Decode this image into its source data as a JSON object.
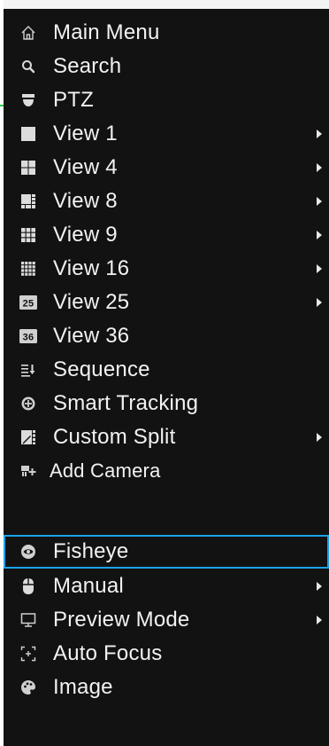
{
  "menu": {
    "items": [
      {
        "label": "Main Menu",
        "icon": "home-icon",
        "submenu": false
      },
      {
        "label": "Search",
        "icon": "search-icon",
        "submenu": false
      },
      {
        "label": "PTZ",
        "icon": "ptz-camera-icon",
        "submenu": false
      },
      {
        "label": "View 1",
        "icon": "view-1-icon",
        "submenu": true
      },
      {
        "label": "View 4",
        "icon": "view-4-icon",
        "submenu": true
      },
      {
        "label": "View 8",
        "icon": "view-8-icon",
        "submenu": true
      },
      {
        "label": "View 9",
        "icon": "view-9-icon",
        "submenu": true
      },
      {
        "label": "View 16",
        "icon": "view-16-icon",
        "submenu": true
      },
      {
        "label": "View 25",
        "icon": "view-25-icon",
        "submenu": true,
        "icon_text": "25"
      },
      {
        "label": "View 36",
        "icon": "view-36-icon",
        "submenu": false,
        "icon_text": "36"
      },
      {
        "label": "Sequence",
        "icon": "sequence-icon",
        "submenu": false
      },
      {
        "label": "Smart Tracking",
        "icon": "smart-tracking-icon",
        "submenu": false
      },
      {
        "label": "Custom Split",
        "icon": "custom-split-icon",
        "submenu": true
      },
      {
        "label": "Add Camera",
        "icon": "add-camera-icon",
        "submenu": false
      },
      {
        "label": "Fisheye",
        "icon": "fisheye-icon",
        "submenu": false,
        "selected": true
      },
      {
        "label": "Manual",
        "icon": "mouse-icon",
        "submenu": true
      },
      {
        "label": "Preview Mode",
        "icon": "monitor-icon",
        "submenu": true
      },
      {
        "label": "Auto Focus",
        "icon": "auto-focus-icon",
        "submenu": false
      },
      {
        "label": "Image",
        "icon": "image-adjust-icon",
        "submenu": false
      }
    ]
  },
  "colors": {
    "menu_background": "#121212",
    "text": "#f2f2f2",
    "selection_border": "#1aa3e8",
    "green_marker": "#2bd04a"
  }
}
